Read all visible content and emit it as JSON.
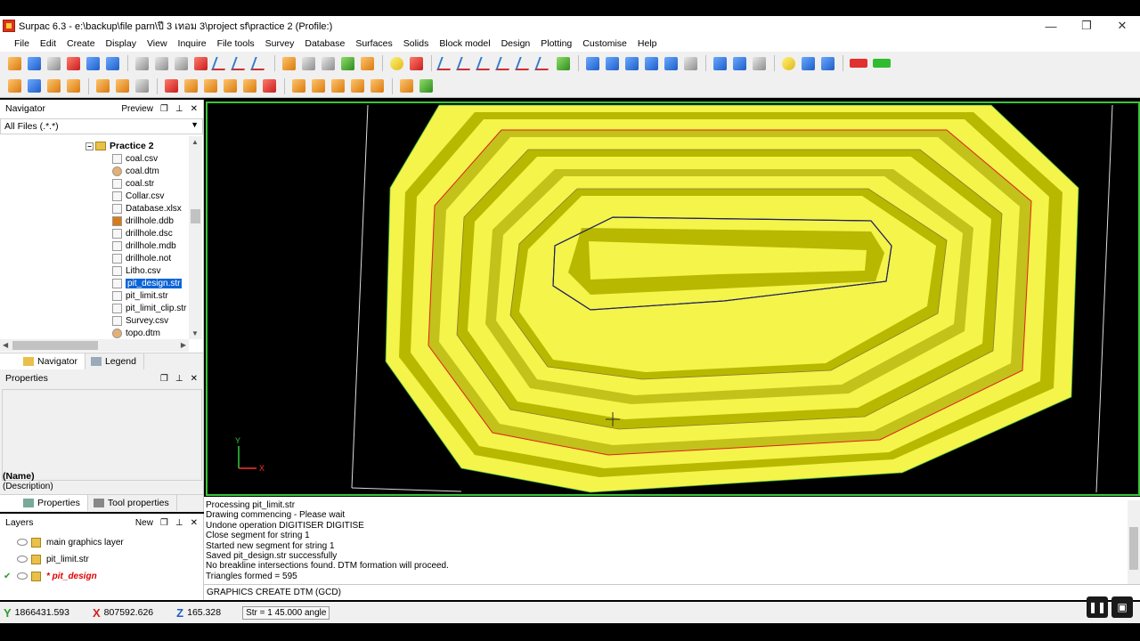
{
  "window": {
    "title": "Surpac 6.3 - e:\\backup\\file parn\\ปี 3 เทอม 3\\project sf\\practice 2 (Profile:)",
    "minimize": "—",
    "restore": "❐",
    "close": "✕"
  },
  "menu": [
    "File",
    "Edit",
    "Create",
    "Display",
    "View",
    "Inquire",
    "File tools",
    "Survey",
    "Database",
    "Surfaces",
    "Solids",
    "Block model",
    "Design",
    "Plotting",
    "Customise",
    "Help"
  ],
  "navigator": {
    "title": "Navigator",
    "preview_label": "Preview",
    "filter": "All Files (.*.*)",
    "root": "Practice 2",
    "files": [
      {
        "name": "coal.csv",
        "selected": false
      },
      {
        "name": "coal.dtm",
        "selected": false
      },
      {
        "name": "coal.str",
        "selected": false
      },
      {
        "name": "Collar.csv",
        "selected": false
      },
      {
        "name": "Database.xlsx",
        "selected": false
      },
      {
        "name": "drillhole.ddb",
        "selected": false
      },
      {
        "name": "drillhole.dsc",
        "selected": false
      },
      {
        "name": "drillhole.mdb",
        "selected": false
      },
      {
        "name": "drillhole.not",
        "selected": false
      },
      {
        "name": "Litho.csv",
        "selected": false
      },
      {
        "name": "pit_design.str",
        "selected": true
      },
      {
        "name": "pit_limit.str",
        "selected": false
      },
      {
        "name": "pit_limit_clip.str",
        "selected": false
      },
      {
        "name": "Survey.csv",
        "selected": false
      },
      {
        "name": "topo.dtm",
        "selected": false
      }
    ],
    "tabs": [
      "Navigator",
      "Legend"
    ]
  },
  "properties": {
    "title": "Properties",
    "name_label": "(Name)",
    "desc_label": "(Description)",
    "tabs": [
      "Properties",
      "Tool properties"
    ]
  },
  "layers": {
    "title": "Layers",
    "new_label": "New",
    "items": [
      {
        "name": "main graphics layer",
        "active": false
      },
      {
        "name": "pit_limit.str",
        "active": false
      },
      {
        "name": "* pit_design",
        "active": true
      }
    ]
  },
  "console": {
    "lines": [
      "Processing pit_limit.str",
      "Drawing commencing - Please wait",
      "Undone operation DIGITISER DIGITISE",
      "Close segment for string 1",
      "Started new segment for string 1",
      "Saved pit_design.str successfully",
      "No breakline intersections found. DTM formation will proceed.",
      "Triangles formed = 595"
    ],
    "command": "GRAPHICS CREATE DTM (GCD)"
  },
  "status": {
    "y_label": "Y",
    "y_value": "1866431.593",
    "x_label": "X",
    "x_value": "807592.626",
    "z_label": "Z",
    "z_value": "165.328",
    "str_text": "Str = 1 45.000 angle"
  },
  "viewport": {
    "axis_y": "Y",
    "axis_x": "X"
  },
  "colors": {
    "accent_border": "#3ac43a",
    "pit_light": "#f4f44a",
    "pit_dark": "#b8b800",
    "viewport_bg": "#000000"
  }
}
